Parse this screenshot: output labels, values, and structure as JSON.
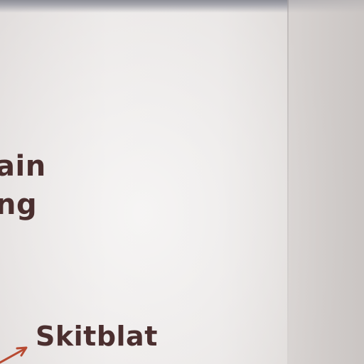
{
  "fragments": {
    "line1": "ain",
    "line2": "ng"
  },
  "label": {
    "text": "Skitblat"
  },
  "colors": {
    "text": "#4a2e2e",
    "arrow": "#b84a32"
  },
  "icons": {
    "arrow": "arrow-pointer-icon"
  }
}
